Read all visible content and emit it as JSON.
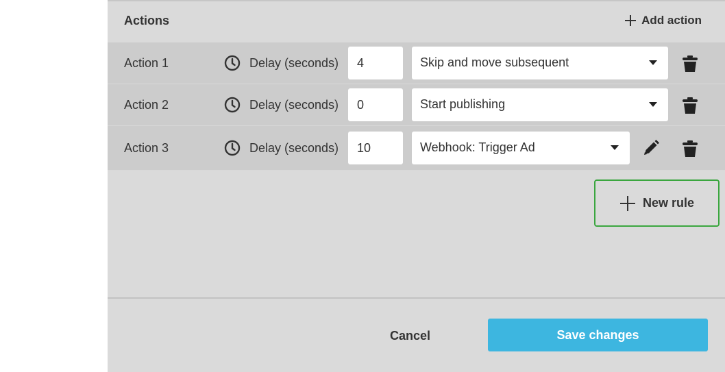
{
  "actions": {
    "title": "Actions",
    "add_action_label": "Add action",
    "rows": [
      {
        "label": "Action 1",
        "delay_label": "Delay (seconds)",
        "delay_value": "4",
        "select_value": "Skip and move subsequent",
        "has_edit": false
      },
      {
        "label": "Action 2",
        "delay_label": "Delay (seconds)",
        "delay_value": "0",
        "select_value": "Start publishing",
        "has_edit": false
      },
      {
        "label": "Action 3",
        "delay_label": "Delay (seconds)",
        "delay_value": "10",
        "select_value": "Webhook: Trigger Ad",
        "has_edit": true
      }
    ]
  },
  "new_rule_label": "New rule",
  "footer": {
    "cancel_label": "Cancel",
    "save_label": "Save changes"
  },
  "colors": {
    "panel_bg": "#dadada",
    "row_bg": "#cccccc",
    "save_button": "#3db6e0",
    "new_rule_border": "#3aa63f"
  },
  "icons": [
    "plus-icon",
    "clock-icon",
    "chevron-down-icon",
    "trash-icon",
    "pencil-icon"
  ]
}
